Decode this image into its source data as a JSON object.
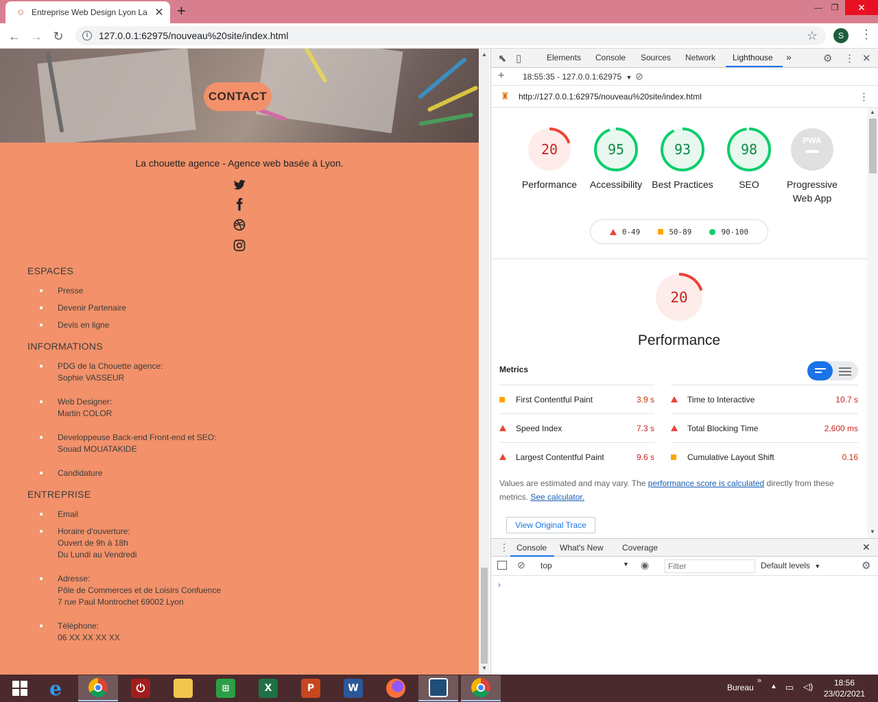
{
  "browser": {
    "tab_title": "Entreprise Web Design Lyon La c",
    "new_tab": "+",
    "url": "127.0.0.1:62975/nouveau%20site/index.html",
    "avatar_letter": "S"
  },
  "site": {
    "contact_button": "CONTACT",
    "tagline": "La chouette agence - Agence web basée à Lyon.",
    "social_icons": [
      "twitter-icon",
      "facebook-icon",
      "dribbble-icon",
      "instagram-icon"
    ],
    "sections": {
      "espaces": {
        "title": "ESPACES",
        "items": [
          "Presse",
          "Devenir Partenaire",
          "Devis en ligne"
        ]
      },
      "informations": {
        "title": "INFORMATIONS",
        "items": [
          {
            "line1": "PDG de la Chouette agence:",
            "line2": "Sophie VASSEUR"
          },
          {
            "line1": "Web Designer:",
            "line2": "Martin COLOR"
          },
          {
            "line1": "Developpeuse Back-end Front-end et SEO:",
            "line2": "Souad MOUATAKIDE"
          },
          {
            "line1": "Candidature"
          }
        ]
      },
      "entreprise": {
        "title": "ENTREPRISE",
        "items": [
          {
            "line1": "Email"
          },
          {
            "line1": "Horaire d'ouverture:",
            "line2": "Ouvert de 9h à 18h",
            "line3": "Du Lundi au Vendredi"
          },
          {
            "line1": "Adresse:",
            "line2": "Pôle de Commerces et de Loisirs Confuence",
            "line3": "7 rue Paul Montrochet 69002 Lyon"
          },
          {
            "line1": "Téléphone:",
            "line2": "06 XX XX XX XX"
          }
        ]
      }
    }
  },
  "devtools": {
    "tabs": [
      "Elements",
      "Console",
      "Sources",
      "Network",
      "Lighthouse"
    ],
    "active_tab": "Lighthouse",
    "more_tabs": "»",
    "report_select": "18:55:35 - 127.0.0.1:62975",
    "report_url": "http://127.0.0.1:62975/nouveau%20site/index.html",
    "scores": [
      {
        "label": "Performance",
        "value": "20",
        "fraction": 0.2,
        "color": "#eb4335",
        "bg": "#fdecea"
      },
      {
        "label": "Accessibility",
        "value": "95",
        "fraction": 0.95,
        "color": "#0cce6b",
        "bg": "#e8f8ef"
      },
      {
        "label": "Best Practices",
        "value": "93",
        "fraction": 0.93,
        "color": "#0cce6b",
        "bg": "#e8f8ef"
      },
      {
        "label": "SEO",
        "value": "98",
        "fraction": 0.98,
        "color": "#0cce6b",
        "bg": "#e8f8ef"
      },
      {
        "label": "Progressive Web App",
        "value": "PWA",
        "fraction": 0,
        "color": "#9e9e9e",
        "bg": "#e0e0e0"
      }
    ],
    "legend": [
      {
        "range": "0-49",
        "shape": "triangle",
        "color": "#eb4335"
      },
      {
        "range": "50-89",
        "shape": "square",
        "color": "#ffa400"
      },
      {
        "range": "90-100",
        "shape": "circle",
        "color": "#0cce6b"
      }
    ],
    "perf_detail": {
      "score": "20",
      "title": "Performance",
      "metrics_title": "Metrics",
      "metrics": [
        {
          "name": "First Contentful Paint",
          "value": "3.9 s",
          "status": "average",
          "color": "#c33300"
        },
        {
          "name": "Time to Interactive",
          "value": "10.7 s",
          "status": "fail",
          "color": "#c7221f"
        },
        {
          "name": "Speed Index",
          "value": "7.3 s",
          "status": "fail",
          "color": "#c7221f"
        },
        {
          "name": "Total Blocking Time",
          "value": "2,600 ms",
          "status": "fail",
          "color": "#c7221f"
        },
        {
          "name": "Largest Contentful Paint",
          "value": "9.6 s",
          "status": "fail",
          "color": "#c7221f"
        },
        {
          "name": "Cumulative Layout Shift",
          "value": "0.16",
          "status": "average",
          "color": "#c33300"
        }
      ],
      "note_pre": "Values are estimated and may vary. The ",
      "note_link1": "performance score is calculated",
      "note_mid": " directly from these metrics. ",
      "note_link2": "See calculator.",
      "trace_button": "View Original Trace"
    },
    "drawer": {
      "tabs": [
        "Console",
        "What's New",
        "Coverage"
      ],
      "context": "top",
      "filter_placeholder": "Filter",
      "levels": "Default levels",
      "prompt": "›"
    }
  },
  "taskbar": {
    "apps": [
      "start",
      "internet-explorer",
      "chrome",
      "power",
      "file-explorer",
      "store",
      "excel",
      "powerpoint",
      "word",
      "firefox",
      "app-square",
      "chrome-active"
    ],
    "tray_label": "Bureau",
    "time": "18:56",
    "date": "23/02/2021"
  }
}
